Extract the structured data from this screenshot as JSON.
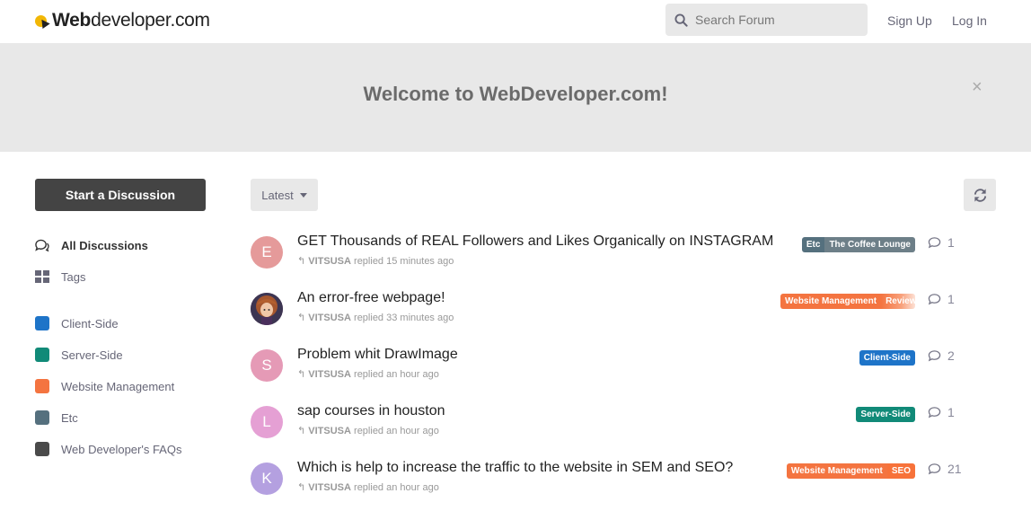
{
  "header": {
    "logo_bold": "Web",
    "logo_rest": "developer.com",
    "search_placeholder": "Search Forum",
    "sign_up": "Sign Up",
    "log_in": "Log In"
  },
  "hero": {
    "title": "Welcome to WebDeveloper.com!",
    "close": "×"
  },
  "sidebar": {
    "start_label": "Start a Discussion",
    "nav": [
      {
        "label": "All Discussions",
        "icon": "comments-icon"
      },
      {
        "label": "Tags",
        "icon": "grid-icon"
      }
    ],
    "categories": [
      {
        "label": "Client-Side",
        "color": "#1e74c8"
      },
      {
        "label": "Server-Side",
        "color": "#118a78"
      },
      {
        "label": "Website Management",
        "color": "#f47440"
      },
      {
        "label": "Etc",
        "color": "#55707e"
      },
      {
        "label": "Web Developer's FAQs",
        "color": "#4a4a4a"
      }
    ]
  },
  "toolbar": {
    "sort_label": "Latest"
  },
  "discussions": [
    {
      "avatar_letter": "E",
      "avatar_color": "#e59a9a",
      "title": "GET Thousands of REAL Followers and Likes Organically on INSTAGRAM",
      "user": "VITSUSA",
      "action": "replied",
      "time": "15 minutes ago",
      "tags": [
        {
          "label": "Etc",
          "color": "#55707e"
        },
        {
          "label": "The Coffee Lounge",
          "color": "#6d7f88"
        }
      ],
      "replies": "1"
    },
    {
      "avatar_letter": "",
      "avatar_color": "#7a4a6a",
      "title": "An error-free webpage!",
      "user": "VITSUSA",
      "action": "replied",
      "time": "33 minutes ago",
      "tags": [
        {
          "label": "Website Management",
          "color": "#f47440"
        },
        {
          "label": "Review",
          "color": "#f7906a"
        }
      ],
      "replies": "1"
    },
    {
      "avatar_letter": "S",
      "avatar_color": "#e59ab6",
      "title": "Problem whit DrawImage",
      "user": "VITSUSA",
      "action": "replied",
      "time": "an hour ago",
      "tags": [
        {
          "label": "Client-Side",
          "color": "#1e74c8"
        }
      ],
      "replies": "2"
    },
    {
      "avatar_letter": "L",
      "avatar_color": "#e5a0d4",
      "title": "sap courses in houston",
      "user": "VITSUSA",
      "action": "replied",
      "time": "an hour ago",
      "tags": [
        {
          "label": "Server-Side",
          "color": "#118a78"
        }
      ],
      "replies": "1"
    },
    {
      "avatar_letter": "K",
      "avatar_color": "#b4a0e0",
      "title": "Which is help to increase the traffic to the website in SEM and SEO?",
      "user": "VITSUSA",
      "action": "replied",
      "time": "an hour ago",
      "tags": [
        {
          "label": "Website Management",
          "color": "#f47440"
        },
        {
          "label": "SEO",
          "color": "#f7723a"
        }
      ],
      "replies": "21"
    }
  ]
}
